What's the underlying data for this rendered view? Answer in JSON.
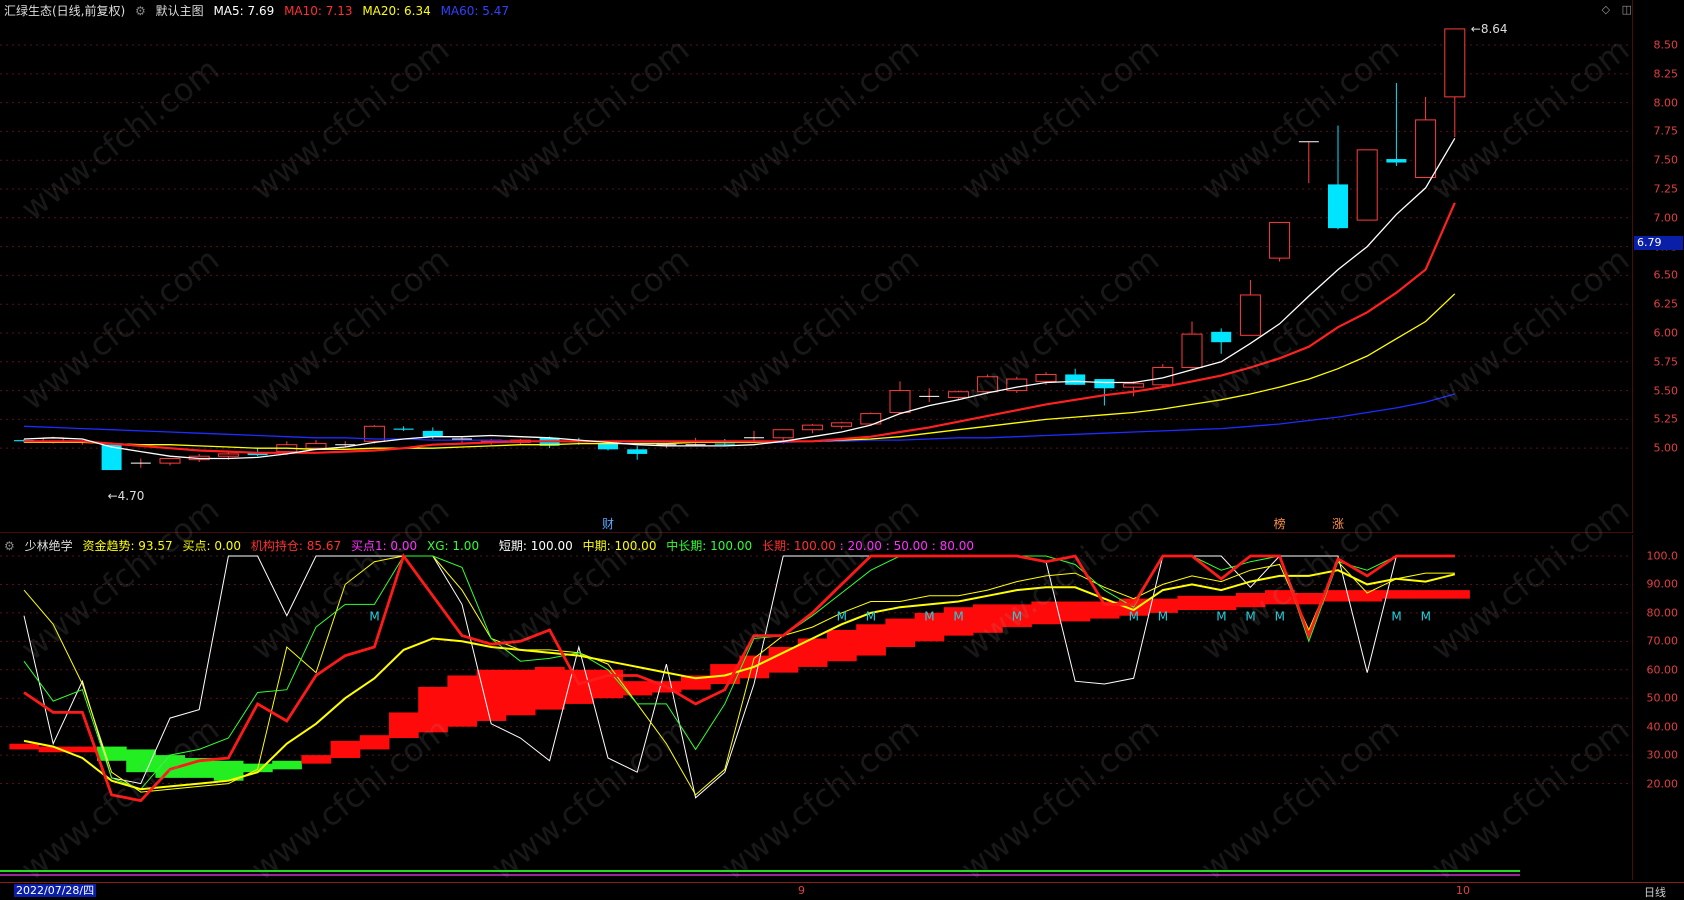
{
  "main_header": {
    "title": "汇绿生态(日线,前复权)",
    "chart_name": "默认主图",
    "ma5": "MA5: 7.69",
    "ma10": "MA10: 7.13",
    "ma20": "MA20: 6.34",
    "ma60": "MA60: 5.47",
    "colors": {
      "ma5": "#ffffff",
      "ma10": "#ff2020",
      "ma20": "#ffff00",
      "ma60": "#1e2cff"
    }
  },
  "price_axis": {
    "ticks": [
      "8.50",
      "8.25",
      "8.00",
      "7.75",
      "7.50",
      "7.25",
      "7.00",
      "6.75",
      "6.50",
      "6.25",
      "6.00",
      "5.75",
      "5.50",
      "5.25",
      "5.00"
    ],
    "current_price": "6.79"
  },
  "annotations": {
    "high": "8.64",
    "low": "4.70",
    "badge_cai": "财",
    "badge_bang": "榜",
    "badge_zhang": "涨"
  },
  "indicator_header": {
    "name": "少林绝学",
    "fund_trend": "资金趋势: 93.57",
    "buy_point": "买点: 0.00",
    "inst_holding": "机构持仓: 85.67",
    "buy_point1": "买点1: 0.00",
    "xg": "XG: 1.00",
    "short_term": "短期: 100.00",
    "mid_term": "中期: 100.00",
    "mid_long_term": "中长期: 100.00",
    "long_term": "长期: 100.00",
    "lvl20": ": 20.00",
    "lvl50": ": 50.00",
    "lvl80": ": 80.00"
  },
  "indicator_axis": {
    "ticks": [
      "100.0",
      "90.00",
      "80.00",
      "70.00",
      "60.00",
      "50.00",
      "40.00",
      "30.00",
      "20.00"
    ]
  },
  "indicator_marker": "M",
  "bottom_bar": {
    "date": "2022/07/28/四",
    "month_9": "9",
    "month_10": "10",
    "period": "日线"
  },
  "watermark": "www.cfchi.com",
  "chart_data": {
    "type": "candlestick",
    "y_range": [
      4.55,
      8.7
    ],
    "candles": [
      {
        "o": 5.07,
        "h": 5.08,
        "l": 5.05,
        "c": 5.06
      },
      {
        "o": 5.06,
        "h": 5.1,
        "l": 5.04,
        "c": 5.09
      },
      {
        "o": 5.05,
        "h": 5.07,
        "l": 5.03,
        "c": 5.06
      },
      {
        "o": 5.03,
        "h": 5.05,
        "l": 4.86,
        "c": 4.81
      },
      {
        "o": 4.87,
        "h": 4.91,
        "l": 4.83,
        "c": 4.87
      },
      {
        "o": 4.87,
        "h": 4.91,
        "l": 4.85,
        "c": 4.91
      },
      {
        "o": 4.9,
        "h": 4.95,
        "l": 4.88,
        "c": 4.93
      },
      {
        "o": 4.93,
        "h": 4.97,
        "l": 4.9,
        "c": 4.95
      },
      {
        "o": 4.96,
        "h": 5.0,
        "l": 4.93,
        "c": 4.94
      },
      {
        "o": 4.97,
        "h": 5.06,
        "l": 4.94,
        "c": 5.03
      },
      {
        "o": 5.0,
        "h": 5.07,
        "l": 4.98,
        "c": 5.04
      },
      {
        "o": 5.03,
        "h": 5.06,
        "l": 5.01,
        "c": 5.03
      },
      {
        "o": 5.06,
        "h": 5.2,
        "l": 5.04,
        "c": 5.19
      },
      {
        "o": 5.17,
        "h": 5.19,
        "l": 5.15,
        "c": 5.16
      },
      {
        "o": 5.15,
        "h": 5.18,
        "l": 5.08,
        "c": 5.1
      },
      {
        "o": 5.08,
        "h": 5.1,
        "l": 5.05,
        "c": 5.08
      },
      {
        "o": 5.06,
        "h": 5.08,
        "l": 5.03,
        "c": 5.07
      },
      {
        "o": 5.05,
        "h": 5.08,
        "l": 5.03,
        "c": 5.07
      },
      {
        "o": 5.09,
        "h": 5.1,
        "l": 5.0,
        "c": 5.02
      },
      {
        "o": 5.06,
        "h": 5.09,
        "l": 5.03,
        "c": 5.05
      },
      {
        "o": 5.04,
        "h": 5.06,
        "l": 4.98,
        "c": 4.99
      },
      {
        "o": 4.99,
        "h": 5.02,
        "l": 4.9,
        "c": 4.95
      },
      {
        "o": 5.03,
        "h": 5.06,
        "l": 5.0,
        "c": 5.03
      },
      {
        "o": 5.03,
        "h": 5.09,
        "l": 5.02,
        "c": 5.03
      },
      {
        "o": 5.04,
        "h": 5.08,
        "l": 5.02,
        "c": 5.03
      },
      {
        "o": 5.09,
        "h": 5.15,
        "l": 5.05,
        "c": 5.09
      },
      {
        "o": 5.09,
        "h": 5.16,
        "l": 5.04,
        "c": 5.16
      },
      {
        "o": 5.16,
        "h": 5.21,
        "l": 5.13,
        "c": 5.2
      },
      {
        "o": 5.19,
        "h": 5.23,
        "l": 5.17,
        "c": 5.22
      },
      {
        "o": 5.21,
        "h": 5.31,
        "l": 5.2,
        "c": 5.3
      },
      {
        "o": 5.31,
        "h": 5.58,
        "l": 5.3,
        "c": 5.5
      },
      {
        "o": 5.45,
        "h": 5.52,
        "l": 5.4,
        "c": 5.45
      },
      {
        "o": 5.44,
        "h": 5.5,
        "l": 5.42,
        "c": 5.49
      },
      {
        "o": 5.49,
        "h": 5.64,
        "l": 5.47,
        "c": 5.62
      },
      {
        "o": 5.5,
        "h": 5.62,
        "l": 5.48,
        "c": 5.6
      },
      {
        "o": 5.58,
        "h": 5.66,
        "l": 5.55,
        "c": 5.64
      },
      {
        "o": 5.64,
        "h": 5.69,
        "l": 5.55,
        "c": 5.55
      },
      {
        "o": 5.6,
        "h": 5.6,
        "l": 5.37,
        "c": 5.52
      },
      {
        "o": 5.53,
        "h": 5.58,
        "l": 5.45,
        "c": 5.56
      },
      {
        "o": 5.55,
        "h": 5.73,
        "l": 5.53,
        "c": 5.7
      },
      {
        "o": 5.7,
        "h": 6.1,
        "l": 5.69,
        "c": 5.99
      },
      {
        "o": 6.01,
        "h": 6.04,
        "l": 5.82,
        "c": 5.92
      },
      {
        "o": 5.98,
        "h": 6.46,
        "l": 5.98,
        "c": 6.33
      },
      {
        "o": 6.65,
        "h": 6.96,
        "l": 6.62,
        "c": 6.96
      },
      {
        "o": 7.66,
        "h": 7.66,
        "l": 7.3,
        "c": 7.66
      },
      {
        "o": 7.29,
        "h": 7.8,
        "l": 6.9,
        "c": 6.91
      },
      {
        "o": 6.98,
        "h": 7.59,
        "l": 6.98,
        "c": 7.59
      },
      {
        "o": 7.51,
        "h": 8.17,
        "l": 7.45,
        "c": 7.48
      },
      {
        "o": 7.35,
        "h": 8.05,
        "l": 7.35,
        "c": 7.85
      },
      {
        "o": 8.05,
        "h": 8.64,
        "l": 7.7,
        "c": 8.64
      }
    ],
    "ma5": [
      5.08,
      5.09,
      5.08,
      5.01,
      4.97,
      4.93,
      4.91,
      4.91,
      4.92,
      4.95,
      4.99,
      5.01,
      5.05,
      5.08,
      5.1,
      5.1,
      5.11,
      5.1,
      5.09,
      5.07,
      5.05,
      5.03,
      5.02,
      5.02,
      5.02,
      5.03,
      5.06,
      5.1,
      5.14,
      5.2,
      5.3,
      5.37,
      5.42,
      5.48,
      5.53,
      5.57,
      5.58,
      5.57,
      5.57,
      5.61,
      5.68,
      5.75,
      5.91,
      6.08,
      6.32,
      6.55,
      6.75,
      7.03,
      7.26,
      7.69
    ],
    "ma10": [
      5.06,
      5.06,
      5.06,
      5.04,
      5.02,
      5.0,
      4.98,
      4.97,
      4.96,
      4.96,
      4.96,
      4.97,
      4.98,
      5.0,
      5.03,
      5.04,
      5.05,
      5.06,
      5.06,
      5.06,
      5.06,
      5.06,
      5.06,
      5.06,
      5.06,
      5.06,
      5.06,
      5.06,
      5.08,
      5.1,
      5.14,
      5.18,
      5.23,
      5.28,
      5.33,
      5.38,
      5.42,
      5.46,
      5.49,
      5.53,
      5.58,
      5.63,
      5.7,
      5.78,
      5.88,
      6.05,
      6.18,
      6.35,
      6.55,
      7.13
    ],
    "ma20": [
      5.05,
      5.05,
      5.05,
      5.04,
      5.03,
      5.03,
      5.02,
      5.01,
      5.0,
      5.0,
      4.99,
      4.99,
      5.0,
      5.0,
      5.0,
      5.01,
      5.02,
      5.03,
      5.03,
      5.04,
      5.04,
      5.04,
      5.04,
      5.05,
      5.05,
      5.05,
      5.06,
      5.06,
      5.07,
      5.08,
      5.1,
      5.13,
      5.16,
      5.19,
      5.22,
      5.25,
      5.27,
      5.29,
      5.31,
      5.34,
      5.38,
      5.42,
      5.47,
      5.53,
      5.6,
      5.69,
      5.8,
      5.95,
      6.1,
      6.34
    ],
    "ma60": [
      5.19,
      5.18,
      5.17,
      5.16,
      5.15,
      5.14,
      5.13,
      5.12,
      5.11,
      5.1,
      5.09,
      5.09,
      5.08,
      5.08,
      5.07,
      5.07,
      5.07,
      5.06,
      5.06,
      5.06,
      5.06,
      5.05,
      5.05,
      5.05,
      5.05,
      5.05,
      5.05,
      5.06,
      5.06,
      5.07,
      5.07,
      5.08,
      5.09,
      5.09,
      5.1,
      5.11,
      5.12,
      5.13,
      5.14,
      5.15,
      5.16,
      5.17,
      5.19,
      5.21,
      5.24,
      5.27,
      5.31,
      5.35,
      5.4,
      5.47
    ],
    "indicator": {
      "y_range": [
        10,
        100
      ],
      "short_term": [
        79,
        34,
        56,
        22,
        20,
        43,
        46,
        100,
        100,
        79,
        100,
        100,
        100,
        100,
        100,
        83,
        41,
        36,
        28,
        68,
        29,
        24,
        62,
        15,
        24,
        55,
        100,
        100,
        100,
        100,
        100,
        100,
        100,
        100,
        100,
        98,
        56,
        55,
        57,
        100,
        100,
        100,
        89,
        100,
        100,
        100,
        59,
        100,
        100,
        100
      ],
      "mid_term": [
        88,
        76,
        55,
        24,
        17,
        18,
        19,
        20,
        25,
        68,
        59,
        90,
        98,
        100,
        100,
        88,
        71,
        67,
        67,
        66,
        62,
        48,
        34,
        16,
        25,
        64,
        72,
        75,
        80,
        84,
        84,
        86,
        86,
        88,
        91,
        93,
        94,
        89,
        85,
        90,
        93,
        91,
        95,
        97,
        74,
        98,
        87,
        92,
        94,
        94
      ],
      "mid_long_term": [
        63,
        49,
        53,
        22,
        18,
        30,
        32,
        36,
        52,
        53,
        75,
        83,
        83,
        100,
        100,
        96,
        71,
        63,
        64,
        66,
        60,
        48,
        48,
        32,
        48,
        71,
        72,
        79,
        87,
        95,
        100,
        100,
        100,
        100,
        100,
        100,
        97,
        88,
        82,
        100,
        100,
        95,
        98,
        100,
        70,
        98,
        95,
        100,
        100,
        100
      ],
      "long_term": [
        52,
        45,
        45,
        16,
        14,
        25,
        28,
        29,
        48,
        42,
        58,
        65,
        68,
        100,
        86,
        72,
        69,
        70,
        74,
        55,
        58,
        58,
        54,
        48,
        53,
        72,
        72,
        80,
        90,
        100,
        100,
        100,
        100,
        100,
        100,
        98,
        100,
        83,
        83,
        100,
        100,
        92,
        100,
        100,
        72,
        99,
        93,
        100,
        100,
        100
      ],
      "fund_trend": [
        35,
        33,
        29,
        21,
        18,
        19,
        20,
        21,
        24,
        34,
        41,
        50,
        57,
        67,
        71,
        70,
        68,
        67,
        66,
        65,
        63,
        61,
        59,
        57,
        58,
        61,
        66,
        71,
        76,
        80,
        82,
        83,
        84,
        86,
        88,
        89,
        89,
        85,
        81,
        88,
        90,
        88,
        91,
        93,
        93,
        95,
        90,
        92,
        91,
        93.57
      ],
      "band": [
        {
          "lo": 32,
          "hi": 34,
          "c": "red"
        },
        {
          "lo": 31,
          "hi": 33,
          "c": "red"
        },
        {
          "lo": 31,
          "hi": 33,
          "c": "red"
        },
        {
          "lo": 28,
          "hi": 33,
          "c": "green"
        },
        {
          "lo": 24,
          "hi": 32,
          "c": "green"
        },
        {
          "lo": 22,
          "hi": 30,
          "c": "green"
        },
        {
          "lo": 22,
          "hi": 29,
          "c": "green"
        },
        {
          "lo": 21,
          "hi": 28,
          "c": "green"
        },
        {
          "lo": 24,
          "hi": 27,
          "c": "green"
        },
        {
          "lo": 25,
          "hi": 28,
          "c": "green"
        },
        {
          "lo": 27,
          "hi": 30,
          "c": "red"
        },
        {
          "lo": 29,
          "hi": 35,
          "c": "red"
        },
        {
          "lo": 32,
          "hi": 37,
          "c": "red"
        },
        {
          "lo": 36,
          "hi": 45,
          "c": "red"
        },
        {
          "lo": 38,
          "hi": 54,
          "c": "red"
        },
        {
          "lo": 40,
          "hi": 58,
          "c": "red"
        },
        {
          "lo": 42,
          "hi": 60,
          "c": "red"
        },
        {
          "lo": 44,
          "hi": 60,
          "c": "red"
        },
        {
          "lo": 46,
          "hi": 61,
          "c": "red"
        },
        {
          "lo": 48,
          "hi": 60,
          "c": "red"
        },
        {
          "lo": 50,
          "hi": 60,
          "c": "red"
        },
        {
          "lo": 51,
          "hi": 56,
          "c": "red"
        },
        {
          "lo": 52,
          "hi": 56,
          "c": "red"
        },
        {
          "lo": 53,
          "hi": 58,
          "c": "red"
        },
        {
          "lo": 55,
          "hi": 62,
          "c": "red"
        },
        {
          "lo": 57,
          "hi": 65,
          "c": "red"
        },
        {
          "lo": 59,
          "hi": 68,
          "c": "red"
        },
        {
          "lo": 61,
          "hi": 71,
          "c": "red"
        },
        {
          "lo": 63,
          "hi": 74,
          "c": "red"
        },
        {
          "lo": 65,
          "hi": 76,
          "c": "red"
        },
        {
          "lo": 68,
          "hi": 78,
          "c": "red"
        },
        {
          "lo": 70,
          "hi": 80,
          "c": "red"
        },
        {
          "lo": 72,
          "hi": 82,
          "c": "red"
        },
        {
          "lo": 73,
          "hi": 83,
          "c": "red"
        },
        {
          "lo": 75,
          "hi": 83,
          "c": "red"
        },
        {
          "lo": 76,
          "hi": 84,
          "c": "red"
        },
        {
          "lo": 77,
          "hi": 84,
          "c": "red"
        },
        {
          "lo": 78,
          "hi": 84,
          "c": "red"
        },
        {
          "lo": 79,
          "hi": 85,
          "c": "red"
        },
        {
          "lo": 80,
          "hi": 85,
          "c": "red"
        },
        {
          "lo": 81,
          "hi": 86,
          "c": "red"
        },
        {
          "lo": 81,
          "hi": 86,
          "c": "red"
        },
        {
          "lo": 82,
          "hi": 87,
          "c": "red"
        },
        {
          "lo": 83,
          "hi": 88,
          "c": "red"
        },
        {
          "lo": 83,
          "hi": 87,
          "c": "red"
        },
        {
          "lo": 84,
          "hi": 88,
          "c": "red"
        },
        {
          "lo": 84,
          "hi": 88,
          "c": "red"
        },
        {
          "lo": 85,
          "hi": 88,
          "c": "red"
        },
        {
          "lo": 85,
          "hi": 88,
          "c": "red"
        },
        {
          "lo": 85,
          "hi": 88,
          "c": "red"
        }
      ],
      "m_markers": [
        12,
        28,
        29,
        31,
        32,
        34,
        38,
        39,
        41,
        42,
        43,
        47,
        48
      ]
    }
  }
}
